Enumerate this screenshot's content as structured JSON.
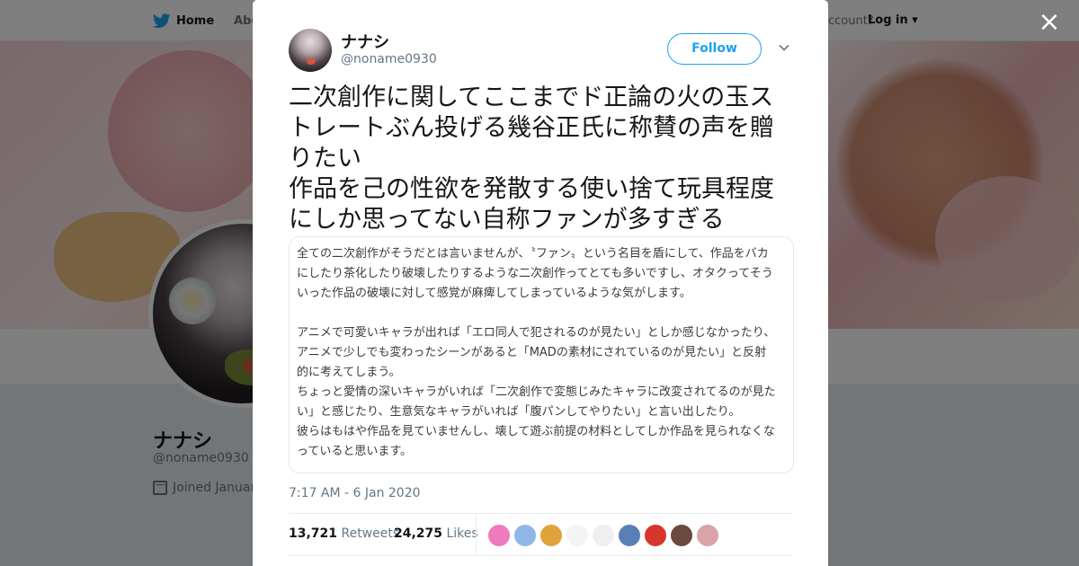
{
  "nav": {
    "home": "Home",
    "about": "Abo",
    "account_prompt": "ccount?",
    "login": "Log in"
  },
  "profile": {
    "name": "ナナシ",
    "handle": "@noname0930",
    "joined": "Joined Januar"
  },
  "tweet": {
    "author_name": "ナナシ",
    "author_handle": "@noname0930",
    "follow_label": "Follow",
    "text_lines": [
      "二次創作に関してここまでド正論の火の玉ス",
      "トレートぶん投げる幾谷正氏に称賛の声を贈",
      "りたい",
      "作品を己の性欲を発散する使い捨て玩具程度",
      "にしか思ってない自称ファンが多すぎる"
    ],
    "image_text_lines": [
      "全ての二次創作がそうだとは言いませんが、〝ファン〟という名目を盾にして、作品をバカ",
      "にしたり茶化したり破壊したりするような二次創作ってとても多いですし、オタクってそう",
      "いった作品の破壊に対して感覚が麻痺してしまっているような気がします。",
      "",
      "アニメで可愛いキャラが出れば「エロ同人で犯されるのが見たい」としか感じなかったり、",
      "アニメで少しでも変わったシーンがあると「MADの素材にされているのが見たい」と反射",
      "的に考えてしまう。",
      "ちょっと愛情の深いキャラがいれば「二次創作で変態じみたキャラに改変されてるのが見た",
      "い」と感じたり、生意気なキャラがいれば「腹パンしてやりたい」と言い出したり。",
      "彼らはもはや作品を見ていませんし、壊して遊ぶ前提の材料としてしか作品を見られなくな",
      "っていると思います。"
    ],
    "timestamp": "7:17 AM - 6 Jan 2020",
    "retweets_count": "13,721",
    "retweets_label": "Retweets",
    "likes_count": "24,275",
    "likes_label": "Likes"
  },
  "likers": [
    {
      "color": "#f07ac0"
    },
    {
      "color": "#8fb8e8"
    },
    {
      "color": "#e0a33c"
    },
    {
      "color": "#f4f4f4"
    },
    {
      "color": "#f0efef"
    },
    {
      "color": "#5a7fb6"
    },
    {
      "color": "#d8362c"
    },
    {
      "color": "#6a4a3c"
    },
    {
      "color": "#d9a3a8"
    }
  ],
  "colors": {
    "accent": "#1da1f2",
    "text": "#14171a",
    "muted": "#657786"
  },
  "icons": {
    "close": "×",
    "dropdown_caret": "▾"
  }
}
